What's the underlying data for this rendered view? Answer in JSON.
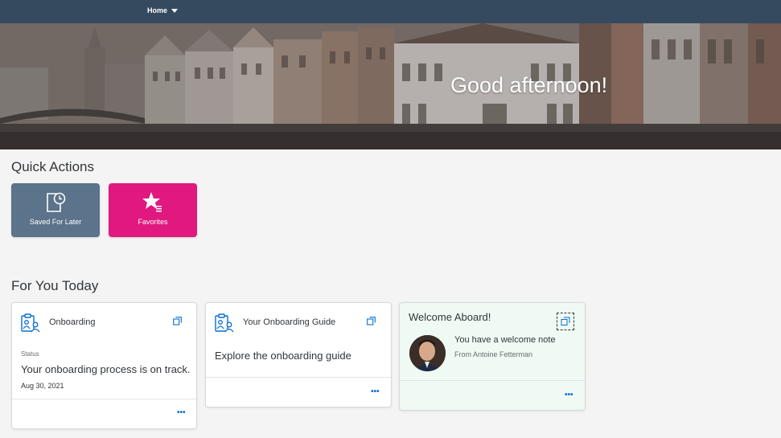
{
  "topbar": {
    "home_label": "Home"
  },
  "banner": {
    "greeting": "Good afternoon!"
  },
  "quick_actions": {
    "title": "Quick Actions",
    "tiles": [
      {
        "label": "Saved For Later",
        "icon": "document-clock-icon",
        "color": "#5b738b"
      },
      {
        "label": "Favorites",
        "icon": "star-list-icon",
        "color": "#e0187f"
      }
    ]
  },
  "for_you_today": {
    "title": "For You Today",
    "cards": [
      {
        "title": "Onboarding",
        "icon": "clipboard-person-icon",
        "status_label": "Status",
        "status_text": "Your onboarding process is on track.",
        "date": "Aug 30, 2021",
        "more": "•••"
      },
      {
        "title": "Your Onboarding Guide",
        "icon": "clipboard-person-icon",
        "body": "Explore the onboarding guide",
        "more": "•••"
      },
      {
        "title": "Welcome Aboard!",
        "note": "You have a welcome note",
        "from": "From Antoine Fetterman",
        "more": "•••"
      }
    ]
  },
  "colors": {
    "shell": "#354a5f",
    "link": "#0a6ed1",
    "welcome_bg": "#eefaf3"
  }
}
